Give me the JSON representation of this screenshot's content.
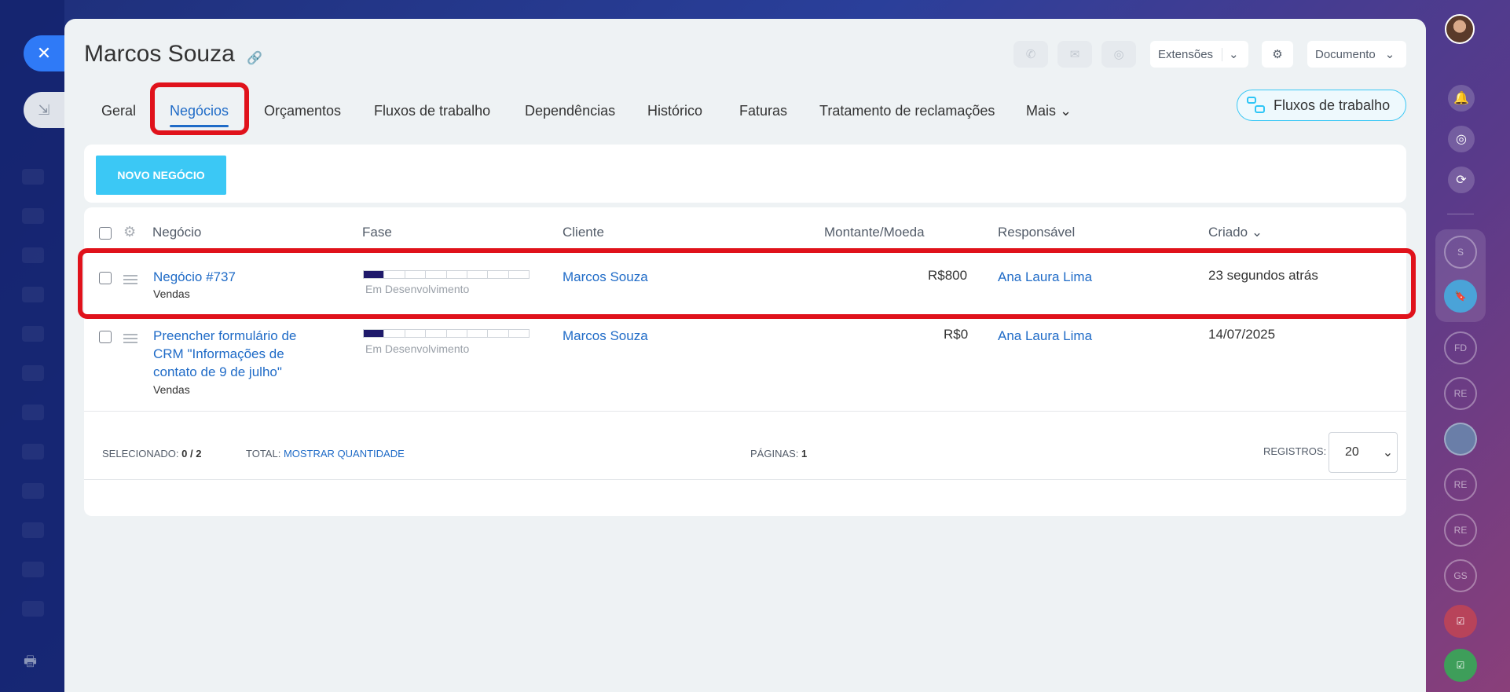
{
  "window": {
    "close_icon": "close-icon",
    "minimize_icon": "minimize-icon"
  },
  "header": {
    "title": "Marcos Souza",
    "extensions_label": "Extensões",
    "document_label": "Documento"
  },
  "tabs": [
    {
      "label": "Geral"
    },
    {
      "label": "Negócios",
      "active": true
    },
    {
      "label": "Orçamentos"
    },
    {
      "label": "Fluxos de trabalho"
    },
    {
      "label": "Dependências"
    },
    {
      "label": "Histórico"
    },
    {
      "label": "Faturas"
    },
    {
      "label": "Tratamento de reclamações"
    },
    {
      "label": "Mais"
    }
  ],
  "workflow_button": "Fluxos de trabalho",
  "new_deal_button": "NOVO NEGÓCIO",
  "table": {
    "columns": [
      "Negócio",
      "Fase",
      "Cliente",
      "Montante/Moeda",
      "Responsável",
      "Criado"
    ],
    "rows": [
      {
        "title": "Negócio #737",
        "pipeline": "Vendas",
        "stage": "Em Desenvolvimento",
        "stage_progress": 0.125,
        "client": "Marcos Souza",
        "amount": "R$800",
        "responsible": "Ana Laura Lima",
        "created": "23 segundos atrás"
      },
      {
        "title_lines": [
          "Preencher formulário de",
          "CRM \"Informações de",
          "contato de 9 de julho\""
        ],
        "pipeline": "Vendas",
        "stage": "Em Desenvolvimento",
        "stage_progress": 0.125,
        "client": "Marcos Souza",
        "amount": "R$0",
        "responsible": "Ana Laura Lima",
        "created": "14/07/2025"
      }
    ]
  },
  "footer": {
    "selected_label": "SELECIONADO:",
    "selected_value": "0 / 2",
    "total_label": "TOTAL:",
    "total_link": "MOSTRAR QUANTIDADE",
    "pages_label": "PÁGINAS:",
    "pages_value": "1",
    "records_label": "REGISTROS:",
    "records_value": "20"
  },
  "right_sidebar": {
    "bubbles": [
      "S",
      "FD",
      "RE",
      "RE",
      "RE",
      "GS"
    ]
  },
  "colors": {
    "accent": "#3bc8f5",
    "link": "#1f6bc7",
    "highlight": "#e0121b",
    "stage_fill": "#1f1a6b"
  }
}
